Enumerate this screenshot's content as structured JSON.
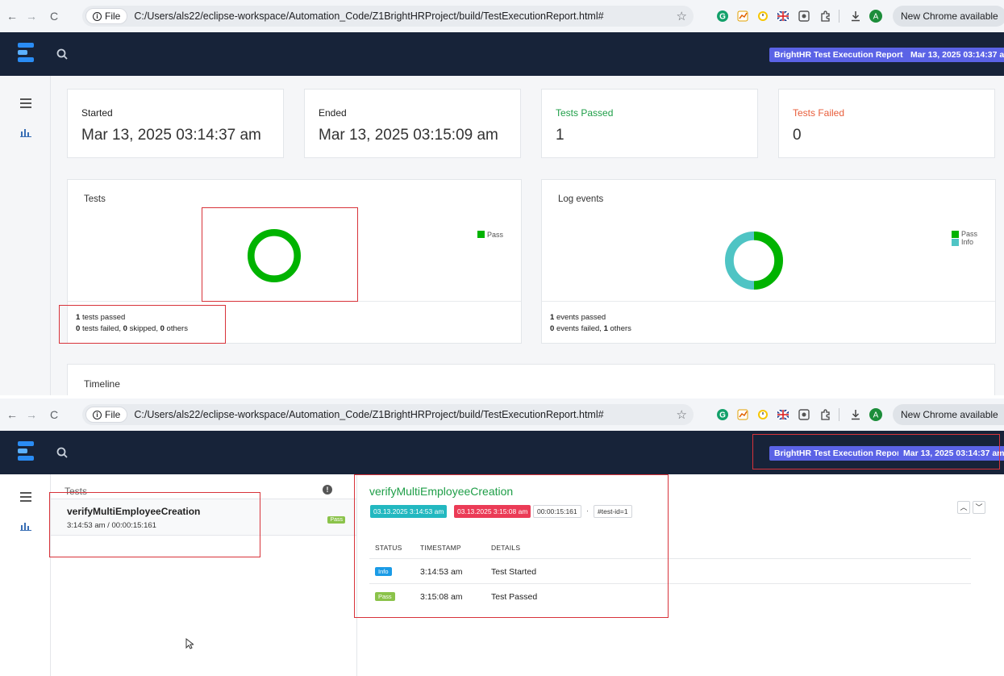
{
  "browser": {
    "file_chip": "File",
    "url": "C:/Users/als22/eclipse-workspace/Automation_Code/Z1BrightHRProject/build/TestExecutionReport.html#",
    "new_chrome": "New Chrome available",
    "avatar_letter": "A"
  },
  "header": {
    "report_title": "BrightHR Test Execution Report",
    "report_date": "Mar 13, 2025 03:14:37 am"
  },
  "dashboard": {
    "cards": [
      {
        "label": "Started",
        "value": "Mar 13, 2025 03:14:37 am"
      },
      {
        "label": "Ended",
        "value": "Mar 13, 2025 03:15:09 am"
      },
      {
        "label": "Tests Passed",
        "value": "1"
      },
      {
        "label": "Tests Failed",
        "value": "0"
      }
    ],
    "tests_panel": {
      "title": "Tests",
      "legend_pass": "Pass",
      "passed_count": "1",
      "passed_text": "tests passed",
      "failed_count": "0",
      "failed_text": "tests failed,",
      "skipped_count": "0",
      "skipped_text": "skipped,",
      "others_count": "0",
      "others_text": "others"
    },
    "log_panel": {
      "title": "Log events",
      "legend_pass": "Pass",
      "legend_info": "Info",
      "passed_count": "1",
      "passed_text": "events passed",
      "failed_count": "0",
      "failed_text": "events failed,",
      "others_count": "1",
      "others_text": "others"
    },
    "timeline_title": "Timeline"
  },
  "charts": {
    "tests_donut": {
      "type": "pie",
      "slices": [
        {
          "label": "Pass",
          "value": 1,
          "color": "#00b300"
        }
      ]
    },
    "log_donut": {
      "type": "pie",
      "slices": [
        {
          "label": "Pass",
          "value": 1,
          "color": "#00b300"
        },
        {
          "label": "Info",
          "value": 1,
          "color": "#4fc4c4"
        }
      ]
    }
  },
  "test_view": {
    "list_title": "Tests",
    "test": {
      "name": "verifyMultiEmployeeCreation",
      "time": "3:14:53 am / 00:00:15:161",
      "status": "Pass"
    },
    "detail": {
      "title": "verifyMultiEmployeeCreation",
      "start_tag": "03.13.2025 3:14:53 am",
      "end_tag": "03.13.2025 3:15:08 am",
      "duration_tag": "00:00:15:161",
      "dot": "·",
      "id_tag": "#test-id=1",
      "columns": [
        "STATUS",
        "TIMESTAMP",
        "DETAILS"
      ],
      "rows": [
        {
          "status": "Info",
          "timestamp": "3:14:53 am",
          "details": "Test Started"
        },
        {
          "status": "Pass",
          "timestamp": "3:15:08 am",
          "details": "Test Passed"
        }
      ]
    }
  },
  "colors": {
    "header_bg": "#172339",
    "badge_bg": "#5b63e6",
    "pass_green": "#00b300",
    "info_teal": "#4fc4c4",
    "annotation_red": "#d8333a"
  }
}
